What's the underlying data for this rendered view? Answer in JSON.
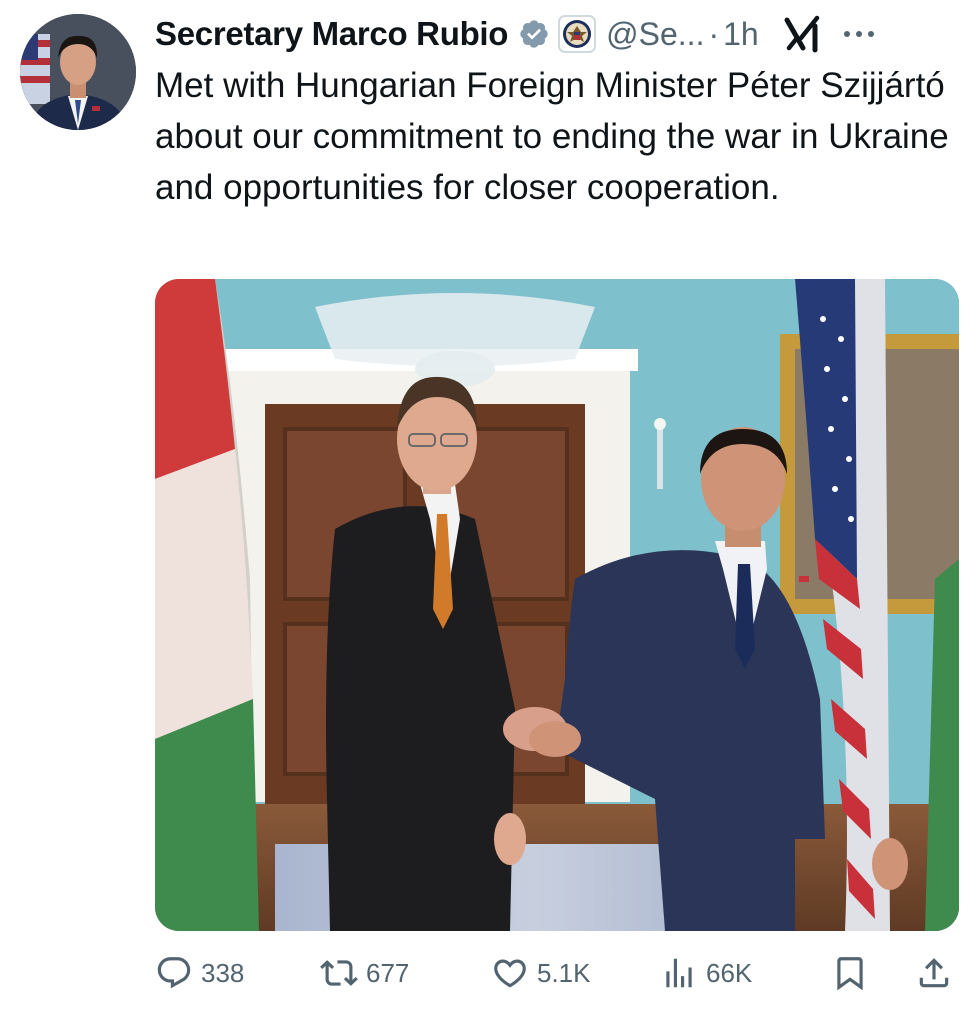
{
  "author": {
    "display_name": "Secretary Marco Rubio",
    "handle": "@Se...",
    "separator": "·",
    "time": "1h",
    "verified_badge": "verified-badge-icon",
    "affiliation_badge": "state-department-seal-icon",
    "avatar": "profile-photo"
  },
  "tweet": {
    "text": "Met with Hungarian Foreign Minister Péter Szijjártó about our commitment to ending the war in Ukraine and opportunities for closer cooperation."
  },
  "media": {
    "kind": "photo",
    "subject": "two-men-handshake"
  },
  "actions": {
    "replies": "338",
    "reposts": "677",
    "likes": "5.1K",
    "views": "66K"
  },
  "icons": {
    "grok": "grok-icon",
    "more": "more-options-icon",
    "reply": "reply-icon",
    "repost": "repost-icon",
    "like": "heart-icon",
    "views": "views-chart-icon",
    "bookmark": "bookmark-icon",
    "share": "share-icon"
  },
  "colors": {
    "text": "#0f1419",
    "secondary": "#536471",
    "verified": "#829aab"
  }
}
